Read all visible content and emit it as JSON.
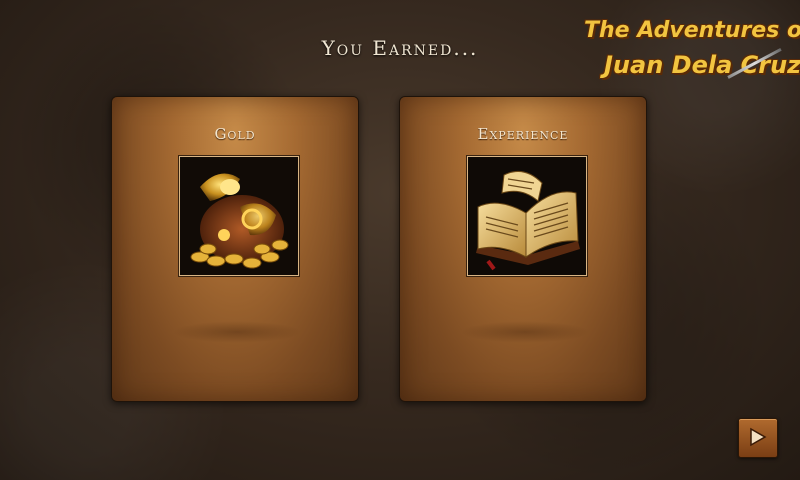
{
  "screen": {
    "heading": "You Earned..."
  },
  "logo": {
    "line1": "The Adventures of",
    "line2": "Juan Dela Cruz"
  },
  "rewards": [
    {
      "label": "Gold",
      "icon": "gold-treasure-icon"
    },
    {
      "label": "Experience",
      "icon": "open-book-icon"
    }
  ],
  "controls": {
    "next_icon": "play-arrow-icon"
  },
  "colors": {
    "accent_gold": "#f2c440",
    "card_leather": "#a56a32",
    "button": "#9a5522"
  }
}
